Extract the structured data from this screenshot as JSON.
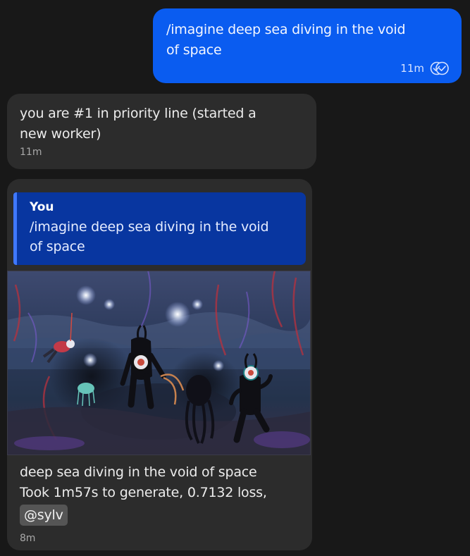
{
  "messages": {
    "outgoing": {
      "text": "/imagine deep sea diving in the void of space",
      "time": "11m",
      "status_icon": "double-check-icon"
    },
    "status": {
      "text": "you are #1 in priority line (started a new worker)",
      "time": "11m"
    },
    "result": {
      "reply": {
        "author": "You",
        "text": "/imagine deep sea diving in the void of space"
      },
      "image_icon": "generated-image",
      "caption_line1": "deep sea diving in the void of space",
      "caption_line2": "Took 1m57s to generate, 0.7132 loss,",
      "mention": "@sylv",
      "time": "8m"
    }
  },
  "colors": {
    "background": "#181818",
    "outgoing_bubble": "#0a5cf0",
    "incoming_bubble": "#2c2c2c",
    "reply_quote": "#0836a0",
    "reply_bar": "#3f78ff",
    "mention_bg": "#555555"
  }
}
